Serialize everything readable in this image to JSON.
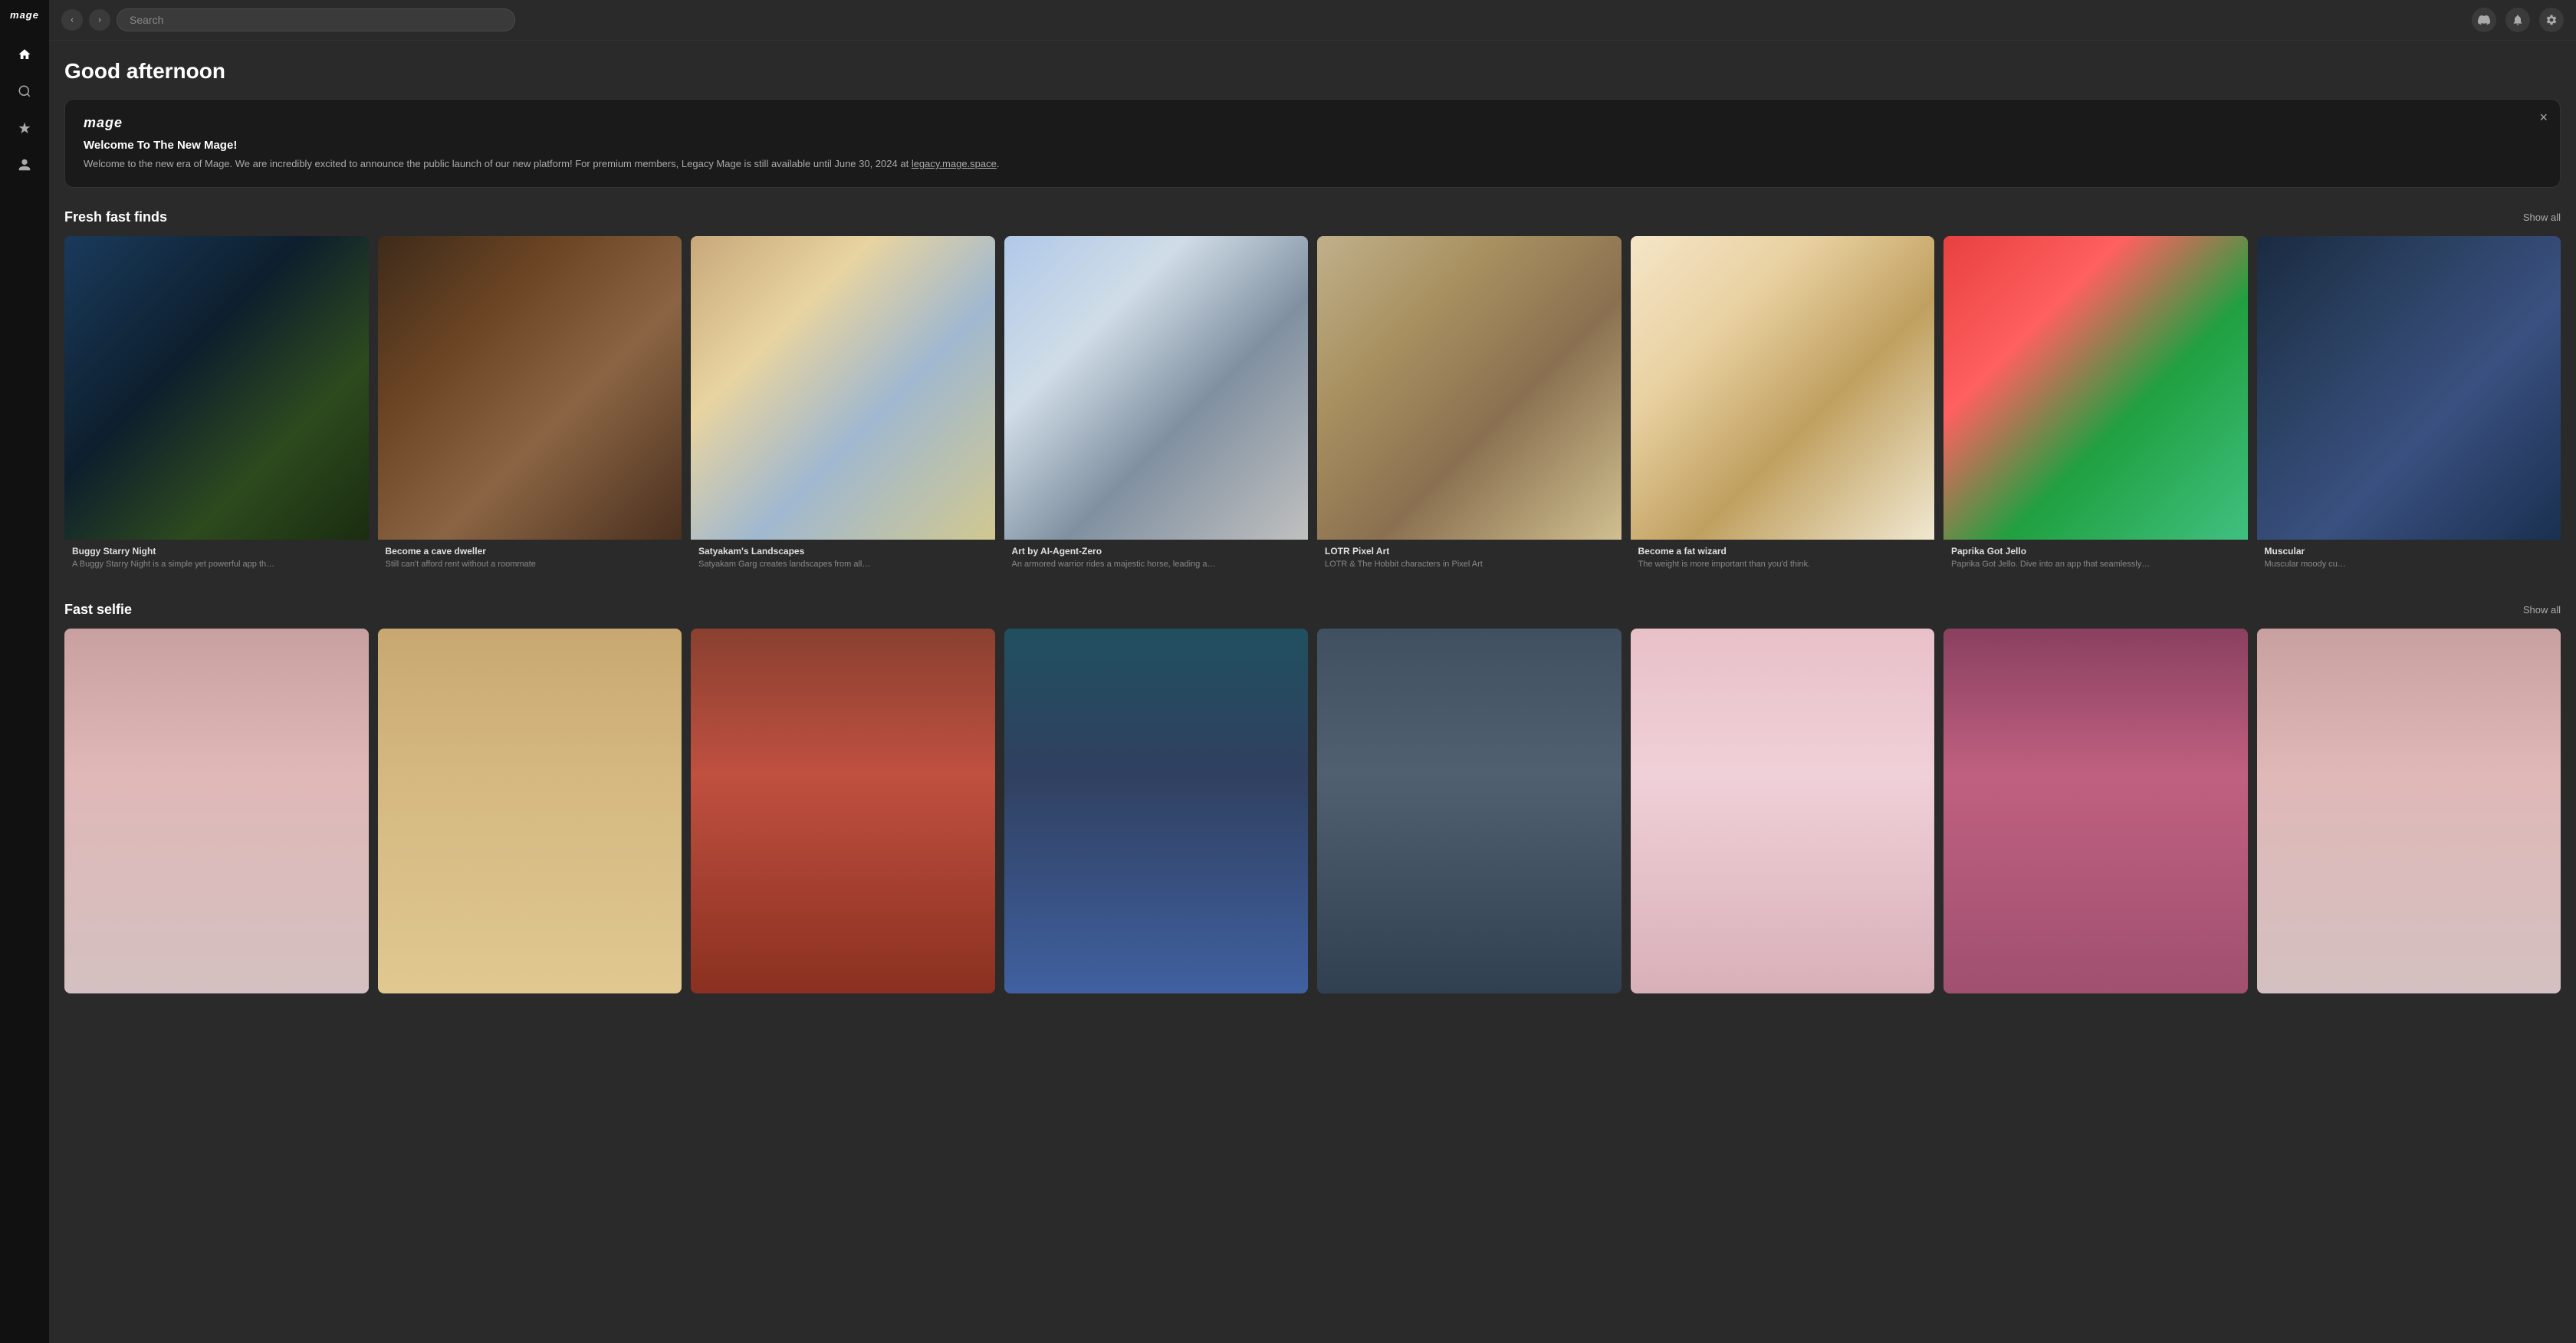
{
  "app": {
    "name": "mage"
  },
  "topbar": {
    "search_placeholder": "Search",
    "icons": [
      "discord",
      "bell",
      "settings"
    ]
  },
  "greeting": "Good afternoon",
  "banner": {
    "logo": "mage",
    "title": "Welcome To The New Mage!",
    "body": "Welcome to the new era of Mage. We are incredibly excited to announce the public launch of our new platform! For premium members, Legacy Mage is still available until June 30, 2024 at legacy.mage.space.",
    "link_text": "legacy.mage.space"
  },
  "sections": {
    "fresh": {
      "title": "Fresh fast finds",
      "show_all": "Show all",
      "cards": [
        {
          "title": "Buggy Starry Night",
          "desc": "A Buggy Starry Night is a simple yet powerful app th…",
          "color": "img-buggy"
        },
        {
          "title": "Become a cave dweller",
          "desc": "Still can't afford rent without a roommate",
          "color": "img-cave"
        },
        {
          "title": "Satyakam's Landscapes",
          "desc": "Satyakam Garg creates landscapes from all…",
          "color": "img-landscape"
        },
        {
          "title": "Art by AI-Agent-Zero",
          "desc": "An armored warrior rides a majestic horse, leading a…",
          "color": "img-warrior"
        },
        {
          "title": "LOTR Pixel Art",
          "desc": "LOTR & The Hobbit characters in Pixel Art",
          "color": "img-lotr"
        },
        {
          "title": "Become a fat wizard",
          "desc": "The weight is more important than you'd think.",
          "color": "img-wizard"
        },
        {
          "title": "Paprika Got Jello",
          "desc": "Paprika Got Jello. Dive into an app that seamlessly…",
          "color": "img-paprika"
        },
        {
          "title": "Muscular",
          "desc": "Muscular moody cu…",
          "color": "img-muscular"
        }
      ]
    },
    "selfie": {
      "title": "Fast selfie",
      "show_all": "Show all",
      "cards": [
        {
          "color": "img-selfie1"
        },
        {
          "color": "img-selfie2"
        },
        {
          "color": "img-selfie3"
        },
        {
          "color": "img-selfie4"
        },
        {
          "color": "img-selfie5"
        },
        {
          "color": "img-selfie6"
        },
        {
          "color": "img-selfie7"
        },
        {
          "color": "img-selfie1"
        }
      ]
    }
  },
  "sidebar": {
    "logo": "mage",
    "items": [
      {
        "name": "home",
        "icon": "⌂",
        "label": "Home"
      },
      {
        "name": "search",
        "icon": "⌕",
        "label": "Search"
      },
      {
        "name": "generate",
        "icon": "✦",
        "label": "Generate"
      },
      {
        "name": "profile",
        "icon": "👤",
        "label": "Profile"
      }
    ]
  }
}
